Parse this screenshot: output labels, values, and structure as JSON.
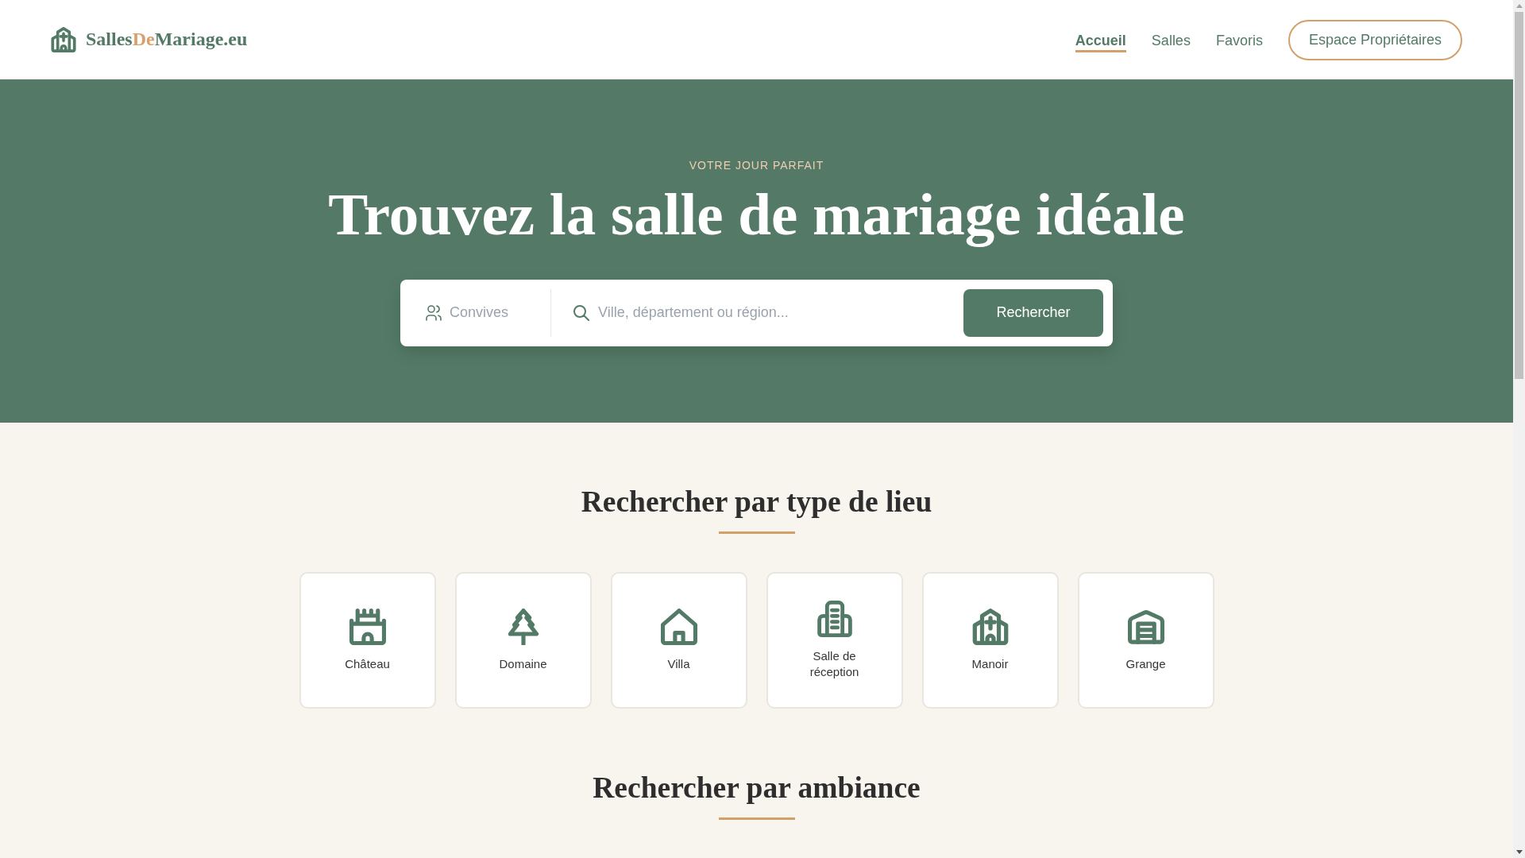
{
  "header": {
    "logo": {
      "parts": [
        {
          "text": "Salles",
          "accent": false
        },
        {
          "text": "De",
          "accent": true
        },
        {
          "text": "Mariage.eu",
          "accent": false
        }
      ]
    },
    "nav": [
      {
        "label": "Accueil",
        "selected": true
      },
      {
        "label": "Salles",
        "selected": false
      },
      {
        "label": "Favoris",
        "selected": false
      }
    ],
    "owner_button": "Espace Propriétaires"
  },
  "hero": {
    "eyebrow": "VOTRE JOUR PARFAIT",
    "title": "Trouvez la salle de mariage idéale",
    "search": {
      "guests_field": {
        "placeholder": "Convives"
      },
      "location_field": {
        "placeholder": "Ville, département ou région..."
      },
      "button": "Rechercher"
    }
  },
  "sections": [
    {
      "title": "Rechercher par type de lieu",
      "venue_types": [
        {
          "label": "Château",
          "kind": "castle"
        },
        {
          "label": "Domaine",
          "kind": "tree"
        },
        {
          "label": "Villa",
          "kind": "house"
        },
        {
          "label": "Salle de réception",
          "kind": "building"
        },
        {
          "label": "Manoir",
          "kind": "church"
        },
        {
          "label": "Grange",
          "kind": "warehouse"
        }
      ]
    },
    {
      "title": "Rechercher par ambiance"
    }
  ]
}
